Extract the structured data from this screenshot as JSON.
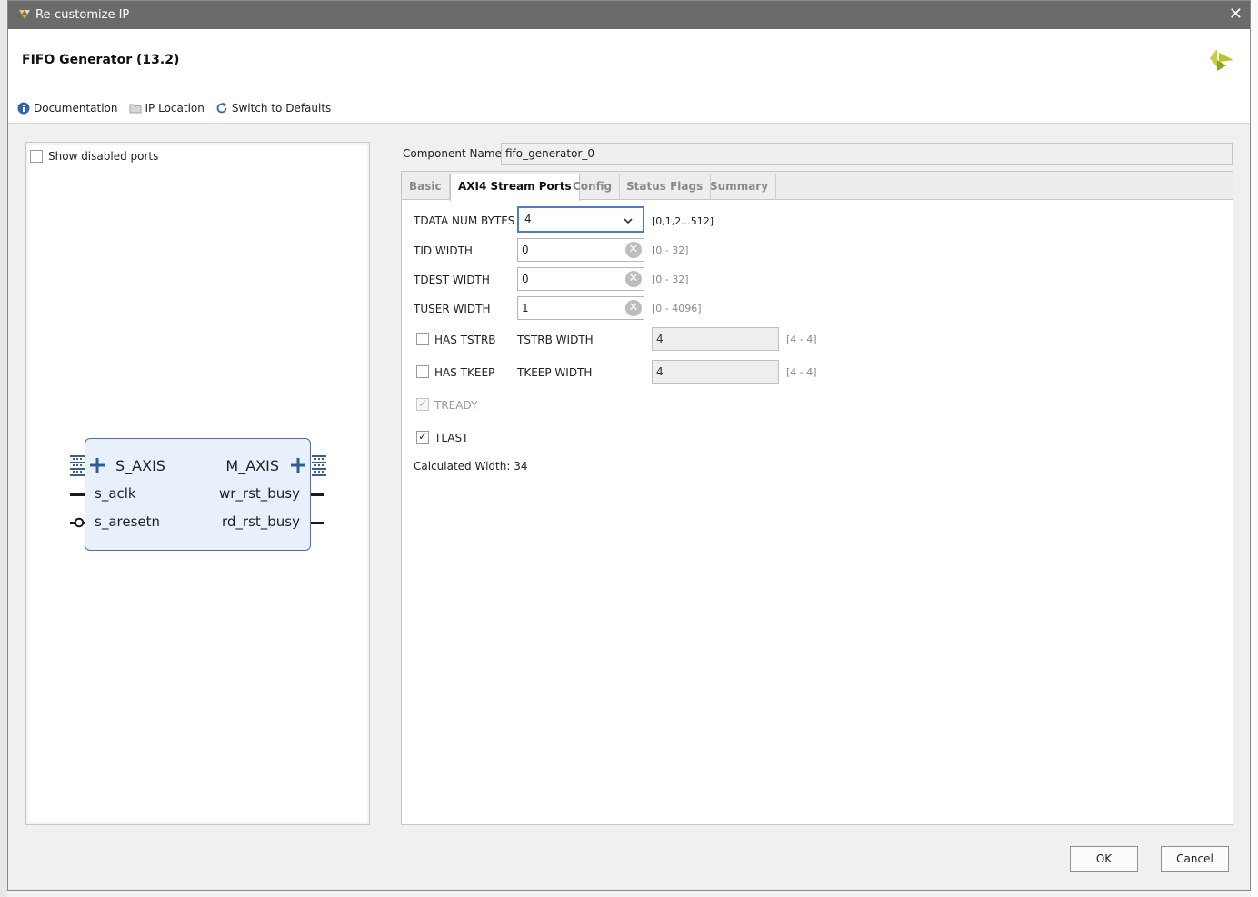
{
  "window": {
    "title": "Re-customize IP",
    "close_label": "✕"
  },
  "header": {
    "title": "FIFO Generator (13.2)",
    "brand_icon": "xilinx-logo-icon"
  },
  "toolbar": {
    "documentation": "Documentation",
    "ip_location": "IP Location",
    "switch_defaults": "Switch to Defaults"
  },
  "left": {
    "show_disabled_label": "Show disabled ports",
    "show_disabled_checked": false,
    "symbol": {
      "s_axis": "S_AXIS",
      "m_axis": "M_AXIS",
      "s_aclk": "s_aclk",
      "s_aresetn": "s_aresetn",
      "wr_rst_busy": "wr_rst_busy",
      "rd_rst_busy": "rd_rst_busy"
    }
  },
  "component": {
    "label": "Component Name",
    "value": "fifo_generator_0"
  },
  "tabs": [
    {
      "label": "Basic",
      "active": false
    },
    {
      "label": "AXI4 Stream Ports",
      "active": true
    },
    {
      "label": "Config",
      "active": false
    },
    {
      "label": "Status Flags",
      "active": false
    },
    {
      "label": "Summary",
      "active": false
    }
  ],
  "fields": {
    "tdata": {
      "label": "TDATA NUM BYTES",
      "value": "4",
      "range": "[0,1,2...512]"
    },
    "tid": {
      "label": "TID WIDTH",
      "value": "0",
      "range": "[0 - 32]"
    },
    "tdest": {
      "label": "TDEST WIDTH",
      "value": "0",
      "range": "[0 - 32]"
    },
    "tuser": {
      "label": "TUSER WIDTH",
      "value": "1",
      "range": "[0 - 4096]"
    },
    "has_tstrb": {
      "label": "HAS TSTRB",
      "checked": false
    },
    "tstrb_width": {
      "label": "TSTRB WIDTH",
      "value": "4",
      "range": "[4 - 4]"
    },
    "has_tkeep": {
      "label": "HAS TKEEP",
      "checked": false
    },
    "tkeep_width": {
      "label": "TKEEP WIDTH",
      "value": "4",
      "range": "[4 - 4]"
    },
    "tready": {
      "label": "TREADY",
      "checked": true,
      "disabled": true
    },
    "tlast": {
      "label": "TLAST",
      "checked": true
    },
    "calculated": "Calculated Width: 34"
  },
  "buttons": {
    "ok": "OK",
    "cancel": "Cancel"
  },
  "colors": {
    "titlebar": "#6b6b6b",
    "accent": "#4a7fc4",
    "symbol_fill": "#e8f1fb",
    "symbol_border": "#4e6f97"
  }
}
